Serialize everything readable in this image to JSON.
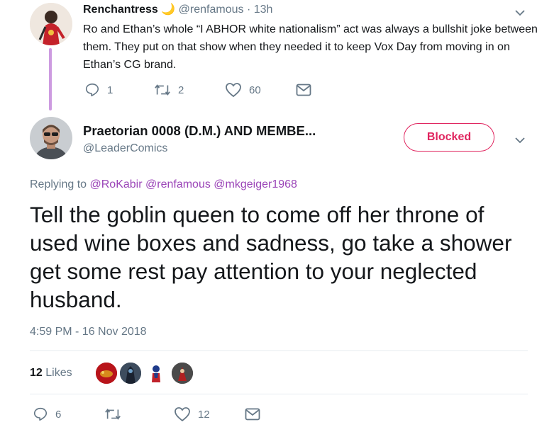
{
  "parent": {
    "name": "Renchantress",
    "emoji": "🌙",
    "handle": "@renfamous",
    "dot": "·",
    "time": "13h",
    "text": "Ro and Ethan’s whole “I ABHOR white nationalism” act was always a bullshit joke between them. They put on that show when they needed it to keep Vox Day from moving in on Ethan’s CG brand.",
    "replies": "1",
    "retweets": "2",
    "likes": "60"
  },
  "tweet": {
    "name": "Praetorian 0008 (D.M.) AND MEMBE...",
    "handle": "@LeaderComics",
    "blocked_label": "Blocked",
    "replying_prefix": "Replying to",
    "mentions": [
      "@RoKabir",
      "@renfamous",
      "@mkgeiger1968"
    ],
    "text": "Tell the goblin queen to come off her throne of used wine boxes and sadness, go take a shower get some rest pay attention to your neglected husband.",
    "timestamp": "4:59 PM - 16 Nov 2018",
    "likes_count": "12",
    "likes_label": "Likes",
    "replies": "6",
    "retweets": "",
    "likes": "12"
  },
  "icons": {
    "reply": "reply-icon",
    "retweet": "retweet-icon",
    "like": "heart-icon",
    "dm": "envelope-icon",
    "more": "chevron-down-icon"
  },
  "colors": {
    "accent": "#9b45b8",
    "blocked": "#e0245e",
    "muted": "#657786",
    "thread_line": "#cd9be0"
  }
}
